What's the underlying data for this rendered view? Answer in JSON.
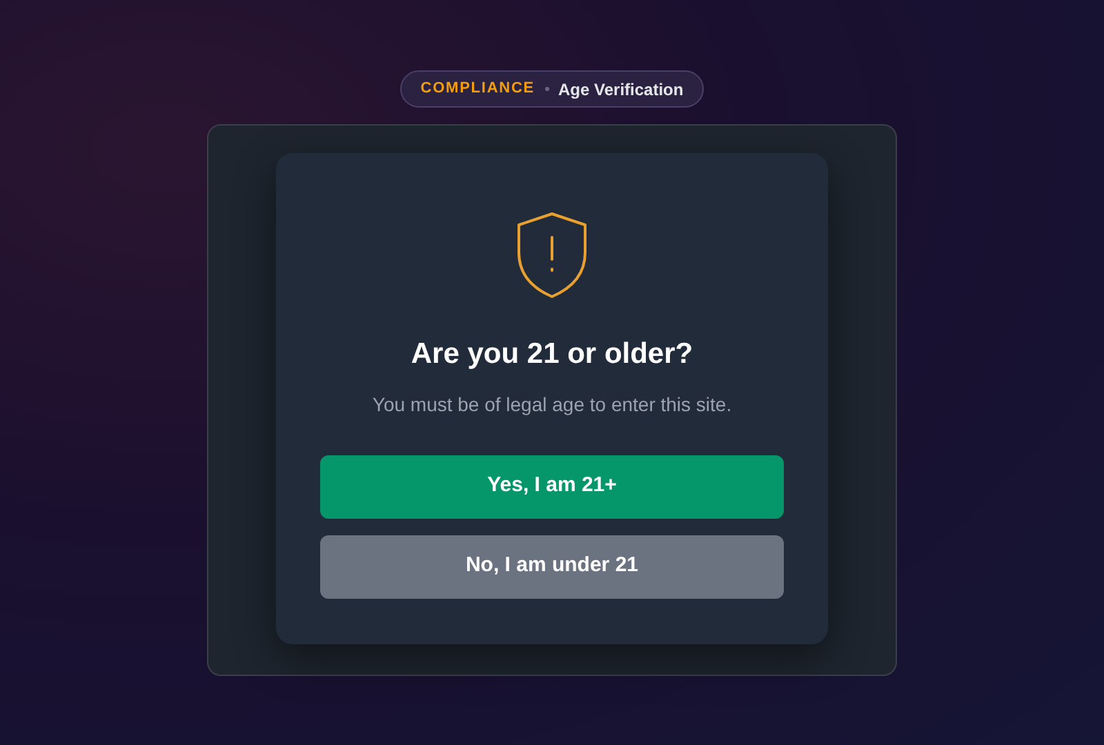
{
  "badge": {
    "category": "COMPLIANCE",
    "title": "Age Verification"
  },
  "dialog": {
    "heading": "Are you 21 or older?",
    "message": "You must be of legal age to enter this site.",
    "buttons": [
      {
        "label": "Yes, I am 21+",
        "kind": "primary"
      },
      {
        "label": "No, I am under 21",
        "kind": "secondary"
      }
    ]
  }
}
